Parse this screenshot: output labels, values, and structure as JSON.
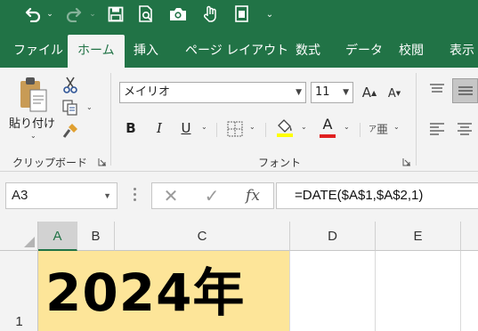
{
  "ribbon_tabs": [
    "ファイル",
    "ホーム",
    "挿入",
    "ページ レイアウト",
    "数式",
    "データ",
    "校閲",
    "表示"
  ],
  "active_tab": "ホーム",
  "clipboard": {
    "paste_label": "貼り付け",
    "group_label": "クリップボード"
  },
  "font": {
    "name": "メイリオ",
    "size": "11",
    "group_label": "フォント"
  },
  "formula_bar": {
    "name_box": "A3",
    "cancel_glyph": "✕",
    "enter_glyph": "✓",
    "fx_glyph": "fx",
    "formula": "=DATE($A$1,$A$2,1)"
  },
  "grid": {
    "columns": [
      "A",
      "B",
      "C",
      "D",
      "E"
    ],
    "rows": [
      "1"
    ],
    "cell_a1": "2024年",
    "selected_column": "A"
  },
  "colors": {
    "excel_green": "#217346",
    "cell_fill": "#fde599",
    "font_color_bar": "#e02020",
    "fill_color_bar": "#ffff00"
  }
}
